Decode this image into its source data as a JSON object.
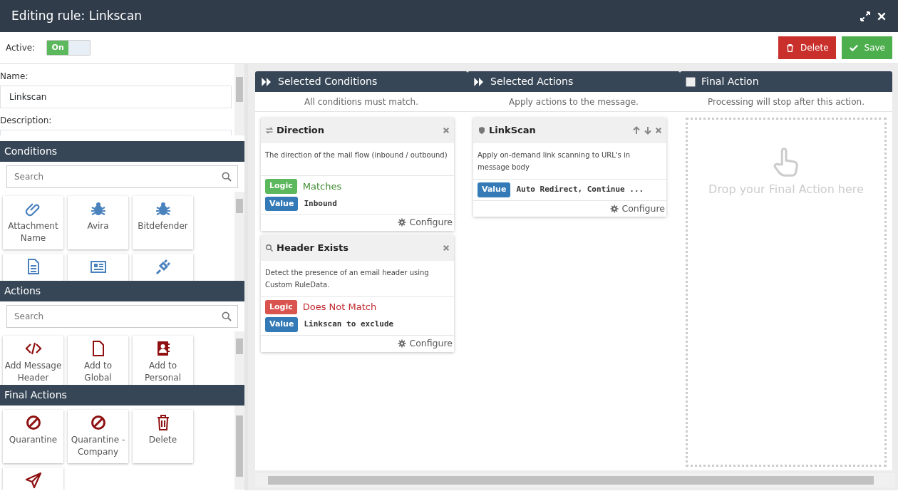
{
  "window": {
    "title": "Editing rule: Linkscan"
  },
  "toolbar": {
    "active_label": "Active:",
    "toggle": {
      "text": "On",
      "on": true
    },
    "buttons": [
      {
        "label": "Delete",
        "kind": "danger"
      },
      {
        "label": "Save",
        "kind": "success"
      }
    ]
  },
  "form": {
    "fields": [
      {
        "label": "Name:",
        "value": "Linkscan"
      },
      {
        "label": "Description:"
      }
    ]
  },
  "palettes": [
    {
      "title": "Conditions",
      "search": {
        "placeholder": "Search"
      },
      "kind": "condition",
      "tiles": [
        {
          "kind": "labeled",
          "label": "Attachment Name"
        },
        {
          "kind": "labeled",
          "label": "Avira"
        },
        {
          "kind": "labeled",
          "label": "Bitdefender"
        },
        {
          "kind": "icon"
        },
        {
          "kind": "icon"
        },
        {
          "kind": "icon"
        }
      ]
    },
    {
      "title": "Actions",
      "search": {
        "placeholder": "Search"
      },
      "kind": "action",
      "tiles": [
        {
          "kind": "labeled",
          "label": "Add Message Header"
        },
        {
          "kind": "labeled",
          "label": "Add to Global"
        },
        {
          "kind": "labeled",
          "label": "Add to Personal"
        }
      ]
    },
    {
      "title": "Final Actions",
      "kind": "action",
      "tiles": [
        {
          "kind": "labeled",
          "label": "Quarantine"
        },
        {
          "kind": "labeled",
          "label": "Quarantine - Company"
        },
        {
          "kind": "labeled",
          "label": "Delete"
        },
        {
          "kind": "icon"
        }
      ]
    }
  ],
  "columns": [
    {
      "title": "Selected Conditions",
      "subtitle": "All conditions must match.",
      "kind": "list",
      "cards": [
        {
          "title": "Direction",
          "description": "The direction of the mail flow (inbound / outbound)",
          "reorder": false,
          "rows": [
            {
              "kind": "logic",
              "badge": "Logic",
              "text": "Matches",
              "matched": true
            },
            {
              "kind": "value",
              "badge": "Value",
              "text": "Inbound"
            }
          ],
          "configure": "Configure"
        },
        {
          "title": "Header Exists",
          "description": "Detect the presence of an email header using Custom RuleData.",
          "reorder": false,
          "rows": [
            {
              "kind": "logic",
              "badge": "Logic",
              "text": "Does Not Match",
              "matched": false
            },
            {
              "kind": "value",
              "badge": "Value",
              "text": "Linkscan to exclude"
            }
          ],
          "configure": "Configure"
        }
      ]
    },
    {
      "title": "Selected Actions",
      "subtitle": "Apply actions to the message.",
      "kind": "list",
      "cards": [
        {
          "title": "LinkScan",
          "description": "Apply on-demand link scanning to URL's in message body",
          "reorder": true,
          "rows": [
            {
              "kind": "value",
              "badge": "Value",
              "text": "Auto Redirect, Continue ..."
            }
          ],
          "configure": "Configure"
        }
      ]
    },
    {
      "title": "Final Action",
      "subtitle": "Processing will stop after this action.",
      "kind": "drop",
      "drop_text": "Drop your Final Action here"
    }
  ]
}
